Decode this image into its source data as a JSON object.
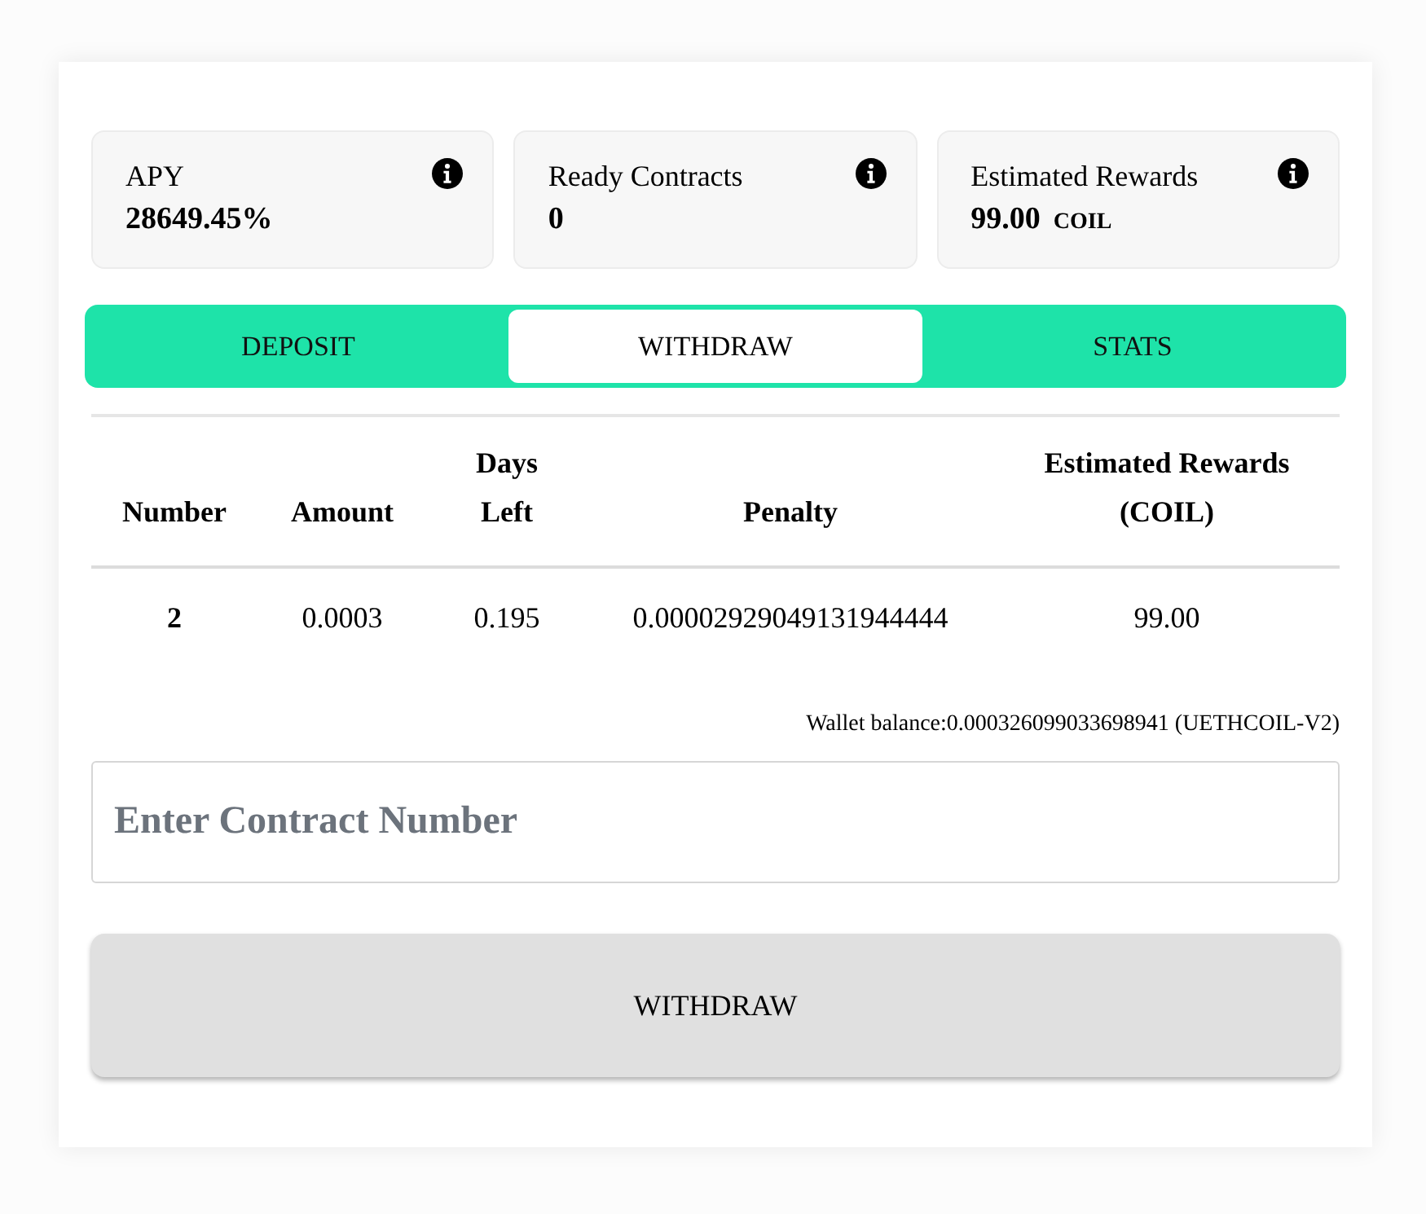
{
  "stats": [
    {
      "label": "APY",
      "value": "28649.45%"
    },
    {
      "label": "Ready Contracts",
      "value": "0"
    },
    {
      "label": "Estimated Rewards",
      "value": "99.00",
      "unit": "COIL"
    }
  ],
  "tabs": [
    {
      "label": "DEPOSIT",
      "selected": false
    },
    {
      "label": "WITHDRAW",
      "selected": true
    },
    {
      "label": "STATS",
      "selected": false
    }
  ],
  "table": {
    "columns": [
      "Number",
      "Amount",
      "Days Left",
      "Penalty",
      "Estimated Rewards (COIL)"
    ],
    "rows": [
      {
        "cells": [
          "2",
          "0.0003",
          "0.195",
          "0.00002929049131944444",
          "99.00"
        ]
      }
    ]
  },
  "wallet_balance": "Wallet balance:0.000326099033698941 (UETHCOIL-V2)",
  "contract_input": {
    "placeholder": "Enter Contract Number"
  },
  "button": "WITHDRAW"
}
